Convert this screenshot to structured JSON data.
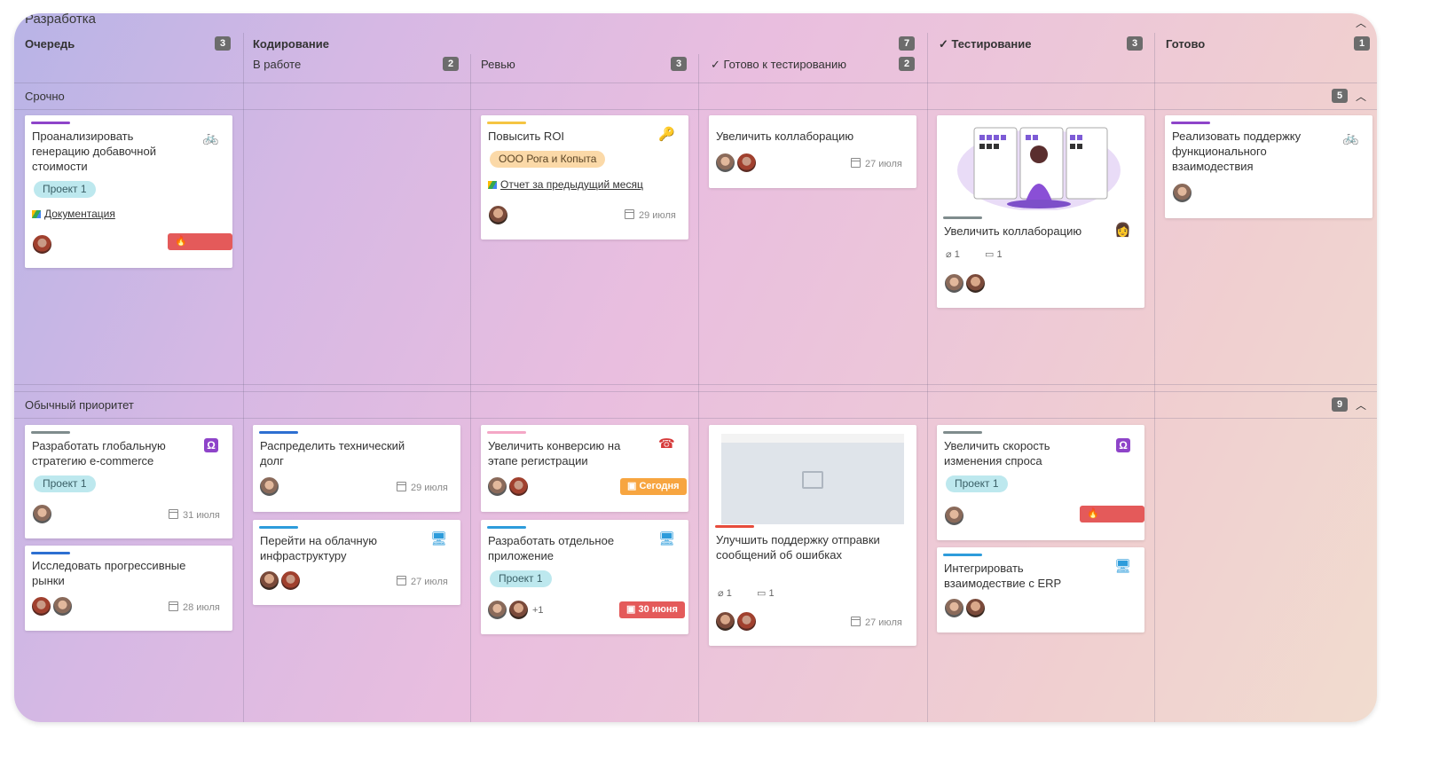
{
  "board": {
    "title": "Разработка"
  },
  "columns": {
    "queue": {
      "label": "Очередь",
      "count": "3"
    },
    "coding": {
      "label": "Кодирование",
      "count": "7"
    },
    "in_work": {
      "label": "В работе",
      "count": "2"
    },
    "review": {
      "label": "Ревью",
      "count": "3"
    },
    "ready_test": {
      "label": "Готово к тестированию",
      "count": "2"
    },
    "testing": {
      "label": "Тестирование",
      "count": "3"
    },
    "done": {
      "label": "Готово",
      "count": "1"
    }
  },
  "lanes": {
    "urgent": {
      "title": "Срочно",
      "count": "5"
    },
    "normal": {
      "title": "Обычный приоритет",
      "count": "9"
    }
  },
  "cards": {
    "c1": {
      "title": "Проанализировать генерацию добавочной стоимости",
      "tag": "Проект 1",
      "link": "Документация",
      "badge": "Срочно",
      "bar_color": "#8e44c9",
      "icon": "bicycle-icon"
    },
    "c2": {
      "title": "Повысить ROI",
      "tag": "ООО Рога и Копыта",
      "link": "Отчет за предыдущий месяц",
      "date": "29 июля",
      "bar_color": "#f5c542",
      "icon": "key-icon"
    },
    "c3": {
      "title": "Увеличить коллаборацию",
      "date": "27 июля"
    },
    "c4": {
      "title": "Увеличить коллаборацию",
      "attachments": "1",
      "comments": "1",
      "bar_color": "#7f8c8d"
    },
    "c5": {
      "title": "Реализовать поддержку функционального взаимодествия",
      "bar_color": "#8e44c9",
      "icon": "bicycle-icon"
    },
    "c6": {
      "title": "Разработать глобальную стратегию e-commerce",
      "tag": "Проект 1",
      "date": "31 июля",
      "bar_color": "#7f8c8d"
    },
    "c7": {
      "title": "Исследовать прогрессивные рынки",
      "date": "28 июля",
      "bar_color": "#2d6fd1"
    },
    "c8": {
      "title": "Распределить технический долг",
      "date": "29 июля",
      "bar_color": "#2d6fd1"
    },
    "c9": {
      "title": "Перейти на облачную инфраструктуру",
      "date": "27 июля",
      "bar_color": "#2d9cdb"
    },
    "c10": {
      "title": "Увеличить конверсию на этапе регистрации",
      "badge": "Сегодня",
      "bar_color": "#f4a7c6",
      "icon": "phone-icon"
    },
    "c11": {
      "title": "Разработать отдельное приложение",
      "tag": "Проект 1",
      "plus": "+1",
      "badge": "30 июня",
      "bar_color": "#2d9cdb",
      "icon": "monitor-icon"
    },
    "c12": {
      "title": "Улучшить поддержку отправки сообщений об ошибках",
      "attachments": "1",
      "comments": "1",
      "date": "27 июля",
      "bar_color": "#e74c3c"
    },
    "c13": {
      "title": "Увеличить скорость изменения спроса",
      "tag": "Проект 1",
      "badge": "Срочно",
      "bar_color": "#7f8c8d"
    },
    "c14": {
      "title": "Интегрировать взаимодествие с ERP",
      "bar_color": "#2d9cdb",
      "icon": "monitor-icon"
    }
  }
}
